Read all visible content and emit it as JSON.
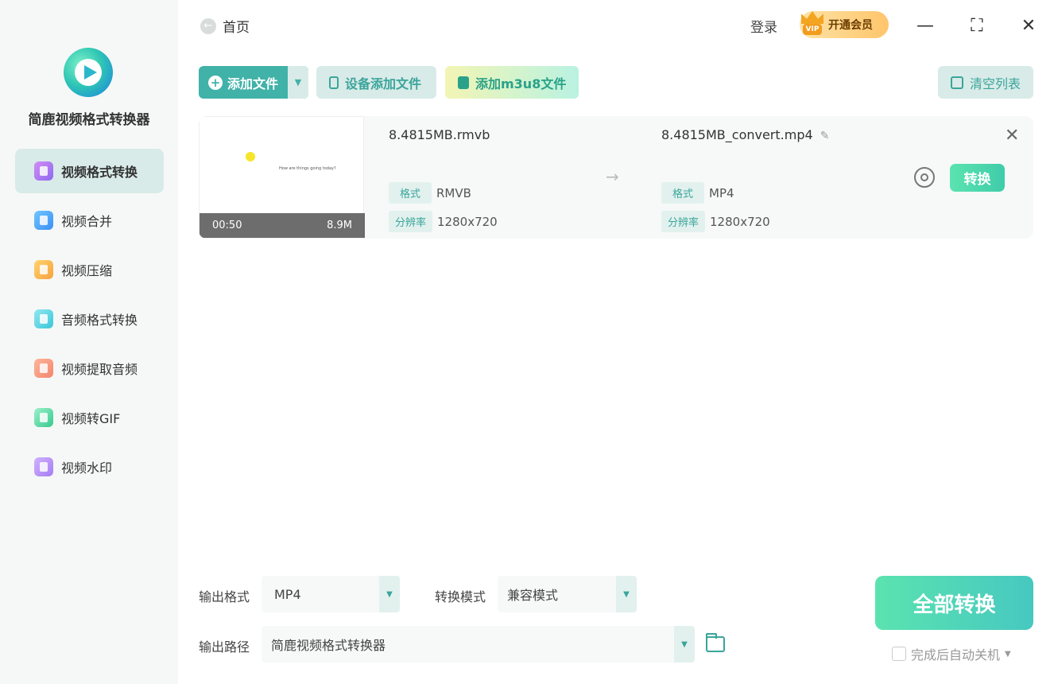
{
  "app": {
    "name": "简鹿视频格式转换器"
  },
  "sidebar": {
    "items": [
      {
        "label": "视频格式转换",
        "icon": "video-convert-icon",
        "active": true
      },
      {
        "label": "视频合并",
        "icon": "video-merge-icon"
      },
      {
        "label": "视频压缩",
        "icon": "video-compress-icon"
      },
      {
        "label": "音频格式转换",
        "icon": "audio-convert-icon"
      },
      {
        "label": "视频提取音频",
        "icon": "extract-audio-icon"
      },
      {
        "label": "视频转GIF",
        "icon": "gif-icon"
      },
      {
        "label": "视频水印",
        "icon": "watermark-icon"
      }
    ]
  },
  "header": {
    "back_label": "首页",
    "login_label": "登录",
    "vip_label": "开通会员",
    "vip_badge": "VIP"
  },
  "toolbar": {
    "add_file": "添加文件",
    "device_add": "设备添加文件",
    "add_m3u8": "添加m3u8文件",
    "clear_list": "清空列表"
  },
  "file": {
    "duration": "00:50",
    "size": "8.9M",
    "thumb_text": "How are things going today?",
    "source_name": "8.4815MB.rmvb",
    "output_name": "8.4815MB_convert.mp4",
    "format_label": "格式",
    "resolution_label": "分辨率",
    "source_format": "RMVB",
    "source_resolution": "1280x720",
    "output_format": "MP4",
    "output_resolution": "1280x720",
    "convert_label": "转换"
  },
  "bottom": {
    "output_format_label": "输出格式",
    "output_format_value": "MP4",
    "mode_label": "转换模式",
    "mode_value": "兼容模式",
    "path_label": "输出路径",
    "path_value": "简鹿视频格式转换器",
    "convert_all": "全部转换",
    "shutdown_label": "完成后自动关机"
  },
  "colors": {
    "accent": "#41b2a8",
    "accent_light": "#d9ebe8",
    "convert_green": "#4fd8ae"
  }
}
